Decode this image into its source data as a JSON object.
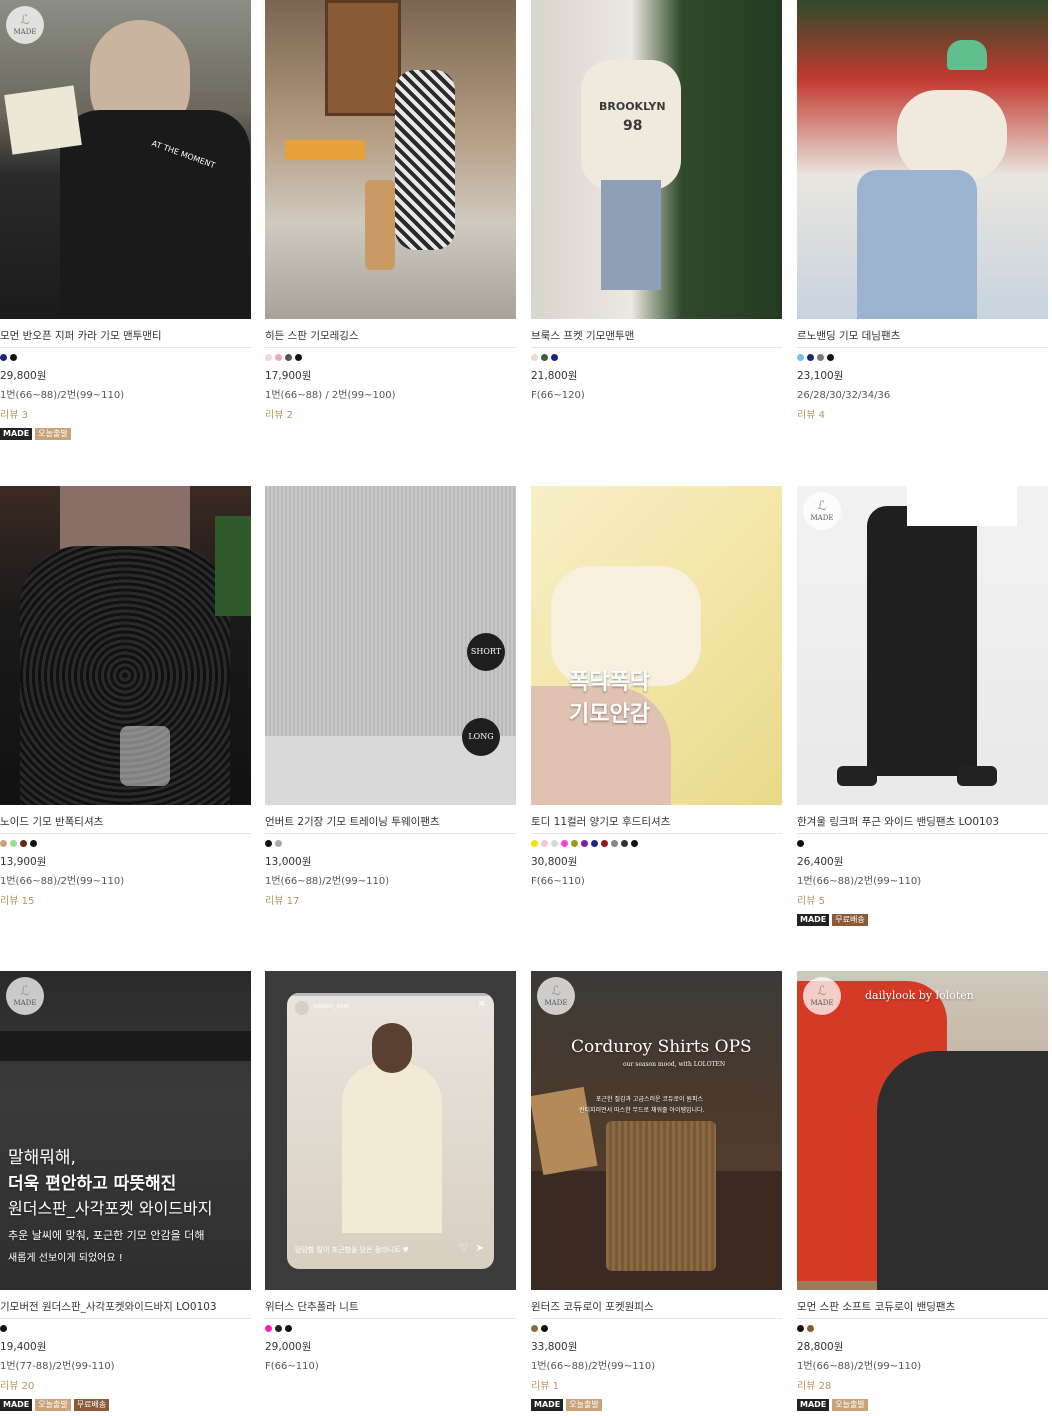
{
  "products": [
    {
      "name": "모먼 반오픈 지퍼 카라 기모 맨투맨티",
      "colors": [
        "#1a237e",
        "#111111"
      ],
      "price": "29,800원",
      "size": "1번(66~88)/2번(99~110)",
      "review": "리뷰 3",
      "badges": [
        "MADE",
        "오늘출발"
      ]
    },
    {
      "name": "히든 스판 기모레깅스",
      "colors": [
        "#f3d6dc",
        "#f2a7b8",
        "#555555",
        "#111111"
      ],
      "price": "17,900원",
      "size": "1번(66~88) / 2번(99~100)",
      "review": "리뷰 2",
      "badges": []
    },
    {
      "name": "브룩스 프켓 기모맨투맨",
      "colors": [
        "#e8dcc8",
        "#3b5e3b",
        "#1a237e"
      ],
      "price": "21,800원",
      "size": "F(66~120)",
      "review": "",
      "badges": []
    },
    {
      "name": "르노밴딩 기모 데님팬츠",
      "colors": [
        "#6fc3e6",
        "#1a237e",
        "#777777",
        "#111111"
      ],
      "price": "23,100원",
      "size": "26/28/30/32/34/36",
      "review": "리뷰 4",
      "badges": []
    },
    {
      "name": "노이드 기모 반폭티셔츠",
      "colors": [
        "#c8a27a",
        "#8fe38f",
        "#5a2b1a",
        "#111111"
      ],
      "price": "13,900원",
      "size": "1번(66~88)/2번(99~110)",
      "review": "리뷰 15",
      "badges": []
    },
    {
      "name": "언버트 2기장 기모 트레이닝 투웨이팬츠",
      "colors": [
        "#111111",
        "#aaaaaa"
      ],
      "price": "13,000원",
      "size": "1번(66~88)/2번(99~110)",
      "review": "리뷰 17",
      "badges": []
    },
    {
      "name": "토디 11컬러 양기모 후드티셔츠",
      "colors": [
        "#f5e100",
        "#f3c6cf",
        "#d8d8d8",
        "#ff3fd6",
        "#9c9c1a",
        "#7a1fa2",
        "#1a237e",
        "#8a1a1a",
        "#888888",
        "#333333",
        "#111111"
      ],
      "price": "30,800원",
      "size": "F(66~110)",
      "review": "",
      "badges": []
    },
    {
      "name": "한겨울 링크퍼 푸근 와이드 밴딩팬츠 LO0103",
      "colors": [
        "#111111"
      ],
      "price": "26,400원",
      "size": "1번(66~88)/2번(99~110)",
      "review": "리뷰 5",
      "badges": [
        "MADE",
        "무료배송"
      ]
    },
    {
      "name": "기모버전 원더스판_사각포켓와이드바지 LO0103",
      "colors": [
        "#111111"
      ],
      "price": "19,400원",
      "size": "1번(77-88)/2번(99-110)",
      "review": "리뷰 20",
      "badges": [
        "MADE",
        "오늘출발",
        "무료배송"
      ]
    },
    {
      "name": "위터스 단추폴라 니트",
      "colors": [
        "#ff1fb5",
        "#222222",
        "#111111"
      ],
      "price": "29,000원",
      "size": "F(66~110)",
      "review": "",
      "badges": []
    },
    {
      "name": "윈터즈 코듀로이 포켓원피스",
      "colors": [
        "#8a6a3a",
        "#111111"
      ],
      "price": "33,800원",
      "size": "1번(66~88)/2번(99~110)",
      "review": "리뷰 1",
      "badges": [
        "MADE",
        "오늘출발"
      ]
    },
    {
      "name": "모먼 스판 소프트 코듀로이 밴딩팬츠",
      "colors": [
        "#111111",
        "#8a5a2a"
      ],
      "price": "28,800원",
      "size": "1번(66~88)/2번(99~110)",
      "review": "리뷰 28",
      "badges": [
        "MADE",
        "오늘출발"
      ]
    }
  ],
  "image_text": {
    "made_logo": "MADE",
    "sweatshirt_print": "AT THE MOMENT",
    "brooklyn": "BROOKLYN",
    "brooklyn_num": "98",
    "short": "SHORT",
    "long": "LONG",
    "fleece_1": "폭닥폭닥",
    "fleece_2": "기모안감",
    "wide_1": "말해뭐해,",
    "wide_2": "더욱 편안하고 따뜻해진",
    "wide_3": "원더스판_사각포켓 와이드바지",
    "wide_4": "추운 날씨에 맞춰, 포근한 기모 안감을 더해",
    "wide_5": "새롭게 선보이게 되었어요 !",
    "insta_caption": "담담함 많이 포근함을 담은 폴라니트 ♥",
    "insta_account": "loloten_com",
    "corduroy_title": "Corduroy Shirts OPS",
    "corduroy_sub": "our season mood, with LOLOTEN",
    "corduroy_desc1": "포근한 질감과 고급스러운 코듀로이 원피스",
    "corduroy_desc2": "린티지러먼서 따스한 무드로 채워줄 아이템입니다.",
    "dailylook": "dailylook by loloten"
  },
  "badge_colors": {
    "MADE": "#222222",
    "오늘출발": "#c7a37a",
    "무료배송": "#8a5a3b"
  }
}
